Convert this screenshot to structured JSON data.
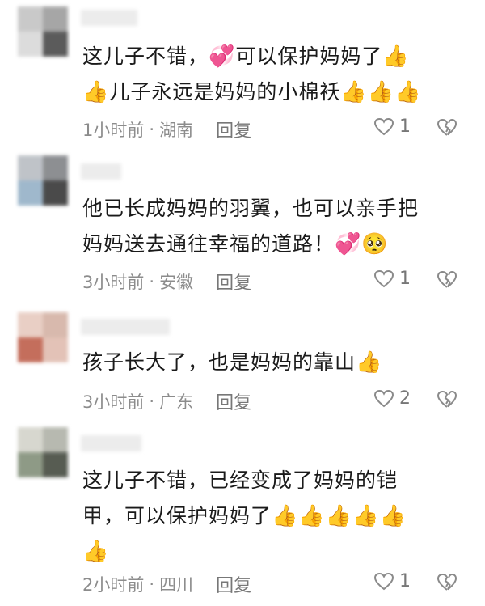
{
  "comments": [
    {
      "text": "这儿子不错，💞可以保护妈妈了👍👍儿子永远是妈妈的小棉袄👍👍👍",
      "lines": [
        "这儿子不错，",
        "可以保护妈妈了",
        "儿子永远是妈妈的小棉袄"
      ],
      "time": "1小时前",
      "location": "湖南",
      "reply_label": "回复",
      "likes": "1"
    },
    {
      "lines": [
        "他已长成妈妈的羽翼，也可以亲手把",
        "妈妈送去通往幸福的道路！"
      ],
      "time": "3小时前",
      "location": "安徽",
      "reply_label": "回复",
      "likes": "1"
    },
    {
      "lines": [
        "孩子长大了，也是妈妈的靠山"
      ],
      "time": "3小时前",
      "location": "广东",
      "reply_label": "回复",
      "likes": "2"
    },
    {
      "lines": [
        "这儿子不错，已经变成了妈妈的铠",
        "甲，可以保护妈妈了"
      ],
      "time": "2小时前",
      "location": "四川",
      "reply_label": "回复",
      "likes": "1"
    }
  ],
  "separator": "·",
  "icons": {
    "like": "heart-outline-icon",
    "dislike": "broken-heart-icon",
    "finger_heart": "finger-heart-emoji",
    "thumbs_up": "thumbs-up-emoji",
    "pleading": "pleading-face-emoji"
  },
  "colors": {
    "text": "#1a1a1a",
    "meta": "#8c8c8c",
    "background": "#ffffff"
  }
}
